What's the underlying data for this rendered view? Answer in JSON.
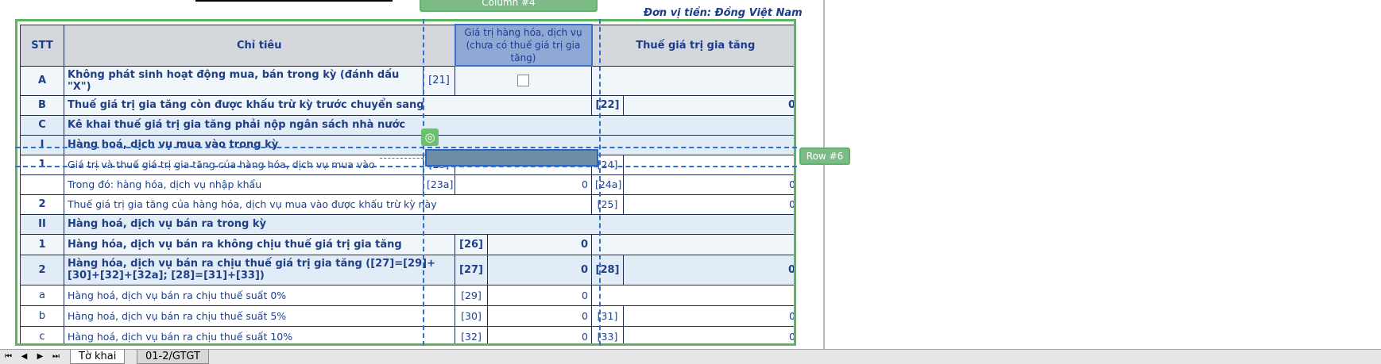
{
  "currency_note": "Đơn vị tiền: Đồng Việt Nam",
  "overlays": {
    "column_tag": "Column #4",
    "row_tag": "Row #6",
    "target_icon": "target-icon"
  },
  "table": {
    "headers": {
      "stt": "STT",
      "chi_tieu": "Chỉ tiêu",
      "gia_tri": "Giá trị hàng hóa, dịch vụ (chưa có thuế giá trị gia tăng)",
      "thue": "Thuế giá trị gia tăng"
    },
    "rows": [
      {
        "stt": "A",
        "label": "Không phát sinh hoạt động mua, bán trong kỳ (đánh dấu \"X\")",
        "code1": "[21]"
      },
      {
        "stt": "B",
        "label": "Thuế giá trị gia tăng còn được khấu trừ kỳ trước chuyển sang",
        "code2": "[22]",
        "val2": "0"
      },
      {
        "stt": "C",
        "label": "Kê khai thuế giá trị gia tăng phải nộp ngân sách nhà nước"
      },
      {
        "stt": "I",
        "label": "Hàng hoá, dịch vụ mua vào trong kỳ"
      },
      {
        "stt": "1",
        "label": "Giá trị và thuế giá trị gia tăng của hàng hóa, dịch vụ mua vào",
        "code1": "[23]",
        "code2": "[24]"
      },
      {
        "stt": "",
        "label": "Trong đó: hàng hóa, dịch vụ nhập khẩu",
        "code1": "[23a]",
        "val1": "0",
        "code2": "[24a]",
        "val2": "0"
      },
      {
        "stt": "2",
        "label": "Thuế giá trị gia tăng của hàng hóa, dịch vụ mua vào được khấu trừ kỳ này",
        "code2": "[25]",
        "val2": "0"
      },
      {
        "stt": "II",
        "label": "Hàng hoá, dịch vụ bán ra trong kỳ"
      },
      {
        "stt": "1",
        "label": "Hàng hóa, dịch vụ bán ra không chịu thuế giá trị gia tăng",
        "code1": "[26]",
        "val1": "0"
      },
      {
        "stt": "2",
        "label": "Hàng hóa, dịch vụ bán ra chịu thuế giá trị gia tăng ([27]=[29]+[30]+[32]+[32a]; [28]=[31]+[33])",
        "code1": "[27]",
        "val1": "0",
        "code2": "[28]",
        "val2": "0"
      },
      {
        "stt": "a",
        "label": "Hàng hoá, dịch vụ bán ra chịu thuế suất 0%",
        "code1": "[29]",
        "val1": "0"
      },
      {
        "stt": "b",
        "label": "Hàng hoá, dịch vụ bán ra chịu thuế suất 5%",
        "code1": "[30]",
        "val1": "0",
        "code2": "[31]",
        "val2": "0"
      },
      {
        "stt": "c",
        "label": "Hàng hoá, dịch vụ bán ra chịu thuế suất 10%",
        "code1": "[32]",
        "val1": "0",
        "code2": "[33]",
        "val2": "0"
      }
    ]
  },
  "sheet_tabs": {
    "active": "Tờ khai",
    "other": "01-2/GTGT"
  },
  "nav": {
    "first": "⏮",
    "prev": "◀",
    "next": "▶",
    "last": "⏭"
  }
}
